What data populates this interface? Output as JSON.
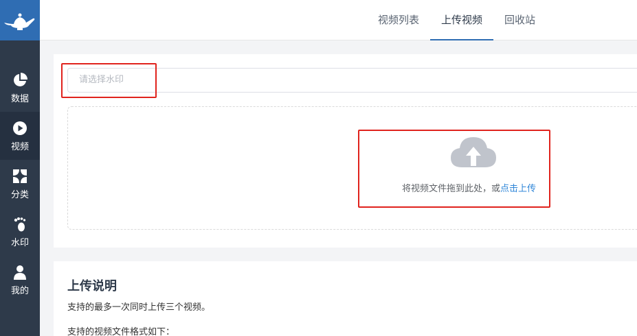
{
  "sidebar": {
    "items": [
      {
        "label": "数据",
        "icon": "pie-chart-icon"
      },
      {
        "label": "视频",
        "icon": "play-icon"
      },
      {
        "label": "分类",
        "icon": "category-icon"
      },
      {
        "label": "水印",
        "icon": "footprint-icon"
      },
      {
        "label": "我的",
        "icon": "user-icon"
      }
    ],
    "active_index": 1
  },
  "header": {
    "tabs": [
      {
        "label": "视频列表"
      },
      {
        "label": "上传视频"
      },
      {
        "label": "回收站"
      }
    ],
    "active_tab": 1
  },
  "upload": {
    "watermark_placeholder": "请选择水印",
    "drop_text": "将视频文件拖到此处，或",
    "drop_link": "点击上传"
  },
  "info": {
    "title": "上传说明",
    "line1": "支持的最多一次同时上传三个视频。",
    "line2": "支持的视频文件格式如下："
  },
  "colors": {
    "sidebar_bg": "#2e3a4a",
    "brand": "#2f6db3",
    "link": "#2f86d8",
    "highlight": "#e0221c"
  }
}
